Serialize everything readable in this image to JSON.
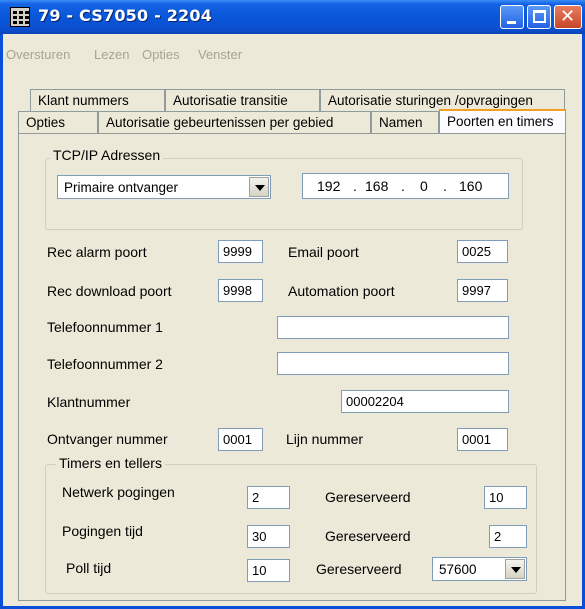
{
  "window": {
    "title": "79 - CS7050 - 2204",
    "buttons": {
      "minimize": "minimize",
      "maximize": "maximize",
      "close": "close"
    }
  },
  "menu": [
    "Oversturen",
    "Lezen",
    "Opties",
    "Venster"
  ],
  "tabs": {
    "row1": [
      "Klant nummers",
      "Autorisatie transitie",
      "Autorisatie sturingen /opvragingen"
    ],
    "row2": [
      "Opties",
      "Autorisatie gebeurtenissen per gebied",
      "Namen",
      "Poorten en timers"
    ],
    "active": "Poorten en timers"
  },
  "tcpip": {
    "group_title": "TCP/IP Adressen",
    "receiver_select": "Primaire ontvanger",
    "ip": [
      "192",
      "168",
      "0",
      "160"
    ]
  },
  "ports": {
    "rec_alarm_label": "Rec alarm poort",
    "rec_alarm_value": "9999",
    "email_label": "Email poort",
    "email_value": "0025",
    "rec_download_label": "Rec download poort",
    "rec_download_value": "9998",
    "automation_label": "Automation poort",
    "automation_value": "9997"
  },
  "phones": {
    "tel1_label": "Telefoonnummer 1",
    "tel1_value": "",
    "tel2_label": "Telefoonnummer 2",
    "tel2_value": ""
  },
  "account": {
    "label": "Klantnummer",
    "value": "00002204"
  },
  "receiver": {
    "receiver_label": "Ontvanger nummer",
    "receiver_value": "0001",
    "line_label": "Lijn nummer",
    "line_value": "0001"
  },
  "timers": {
    "group_title": "Timers en tellers",
    "net_attempts_label": "Netwerk pogingen",
    "net_attempts_value": "2",
    "reserved1_label": "Gereserveerd",
    "reserved1_value": "10",
    "attempt_time_label": "Pogingen tijd",
    "attempt_time_value": "30",
    "reserved2_label": "Gereserveerd",
    "reserved2_value": "2",
    "poll_label": "Poll tijd",
    "poll_value": "10",
    "reserved3_label": "Gereserveerd",
    "reserved3_value": "57600"
  },
  "colors": {
    "titlebar": "#0a56d8",
    "active_tab_accent": "#f1a022",
    "window_bg": "#ece9d8",
    "field_border": "#7f9db9"
  }
}
